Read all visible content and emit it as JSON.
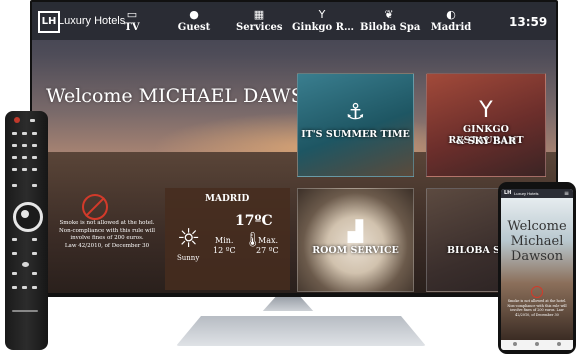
{
  "brand": {
    "logo": "LH",
    "name": "Luxury Hotels"
  },
  "nav": [
    {
      "label": "TV",
      "icon": "tv-icon",
      "glyph": "▭"
    },
    {
      "label": "Guest",
      "icon": "person-icon",
      "glyph": "●"
    },
    {
      "label": "Services",
      "icon": "grid-icon",
      "glyph": "▦"
    },
    {
      "label": "Ginkgo R…",
      "icon": "cocktail-icon",
      "glyph": "Y"
    },
    {
      "label": "Biloba Spa",
      "icon": "leaf-icon",
      "glyph": "❦"
    },
    {
      "label": "Madrid",
      "icon": "weather-icon",
      "glyph": "◐"
    }
  ],
  "clock": "13:59",
  "welcome": "Welcome MICHAEL DAWSON",
  "tiles": {
    "summer": {
      "label": "IT'S SUMMER TIME",
      "glyph": "⚓"
    },
    "ginkgo": {
      "label1": "GINKGO RESTAURANT",
      "label2": "& SKY BAR",
      "glyph": "Y"
    },
    "room": {
      "label": "ROOM SERVICE",
      "glyph": "▟"
    },
    "biloba": {
      "label": "BILOBA S",
      "glyph": "❦"
    }
  },
  "weather": {
    "city": "MADRID",
    "temp": "17ºC",
    "condition": "Sunny",
    "min_label": "Min.",
    "min": "12 ºC",
    "max_label": "Max.",
    "max": "27 ºC"
  },
  "smoking_notice": {
    "line1": "Smoke is not allowed at the hotel.",
    "line2": "Non-compliance with this rule will",
    "line3": "involve fines of 200 euros.",
    "line4": "Law 42/2010, of December 30"
  },
  "phone": {
    "logo": "LH",
    "brand": "Luxury Hotels",
    "welcome1": "Welcome",
    "welcome2": "Michael",
    "welcome3": "Dawson",
    "notice": "Smoke is not allowed at the hotel. Non-compliance with this rule will involve fines of 200 euros. Law 42/2010, of December 30"
  }
}
